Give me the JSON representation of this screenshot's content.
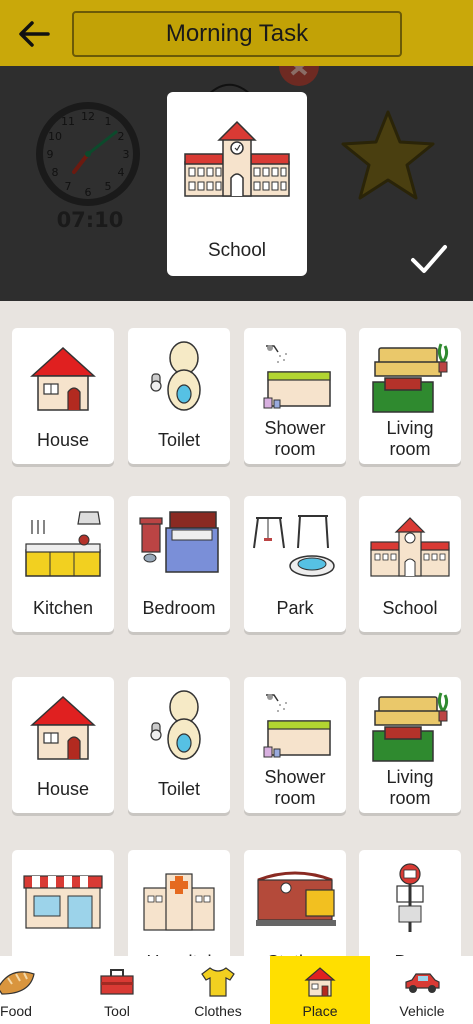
{
  "header": {
    "back_icon": "arrow-left-icon",
    "title": "Morning Task"
  },
  "preview": {
    "clock_time": "07:10",
    "selected_item": "School",
    "confirm_icon": "checkmark-icon"
  },
  "grid": {
    "cards": [
      {
        "label": "House",
        "icon": "house-icon"
      },
      {
        "label": "Toilet",
        "icon": "toilet-icon"
      },
      {
        "label": "Shower room",
        "icon": "bathtub-icon"
      },
      {
        "label": "Living room",
        "icon": "sofa-icon"
      },
      {
        "label": "Kitchen",
        "icon": "kitchen-icon"
      },
      {
        "label": "Bedroom",
        "icon": "bed-icon"
      },
      {
        "label": "Park",
        "icon": "swing-icon"
      },
      {
        "label": "School",
        "icon": "school-icon"
      },
      {
        "label": "House",
        "icon": "house-icon"
      },
      {
        "label": "Toilet",
        "icon": "toilet-icon"
      },
      {
        "label": "Shower room",
        "icon": "bathtub-icon"
      },
      {
        "label": "Living room",
        "icon": "sofa-icon"
      },
      {
        "label": "",
        "icon": "shop-icon"
      },
      {
        "label": "Hospital",
        "icon": "hospital-icon"
      },
      {
        "label": "Station",
        "icon": "station-icon"
      },
      {
        "label": "Bus",
        "icon": "bus-stop-icon"
      }
    ]
  },
  "bottom_nav": {
    "items": [
      {
        "label": "Food",
        "icon": "bread-icon"
      },
      {
        "label": "Tool",
        "icon": "toolbox-icon"
      },
      {
        "label": "Clothes",
        "icon": "tshirt-icon"
      },
      {
        "label": "Place",
        "icon": "house-icon",
        "active": true
      },
      {
        "label": "Vehicle",
        "icon": "car-icon"
      }
    ],
    "active_color": "#ffdf00"
  }
}
